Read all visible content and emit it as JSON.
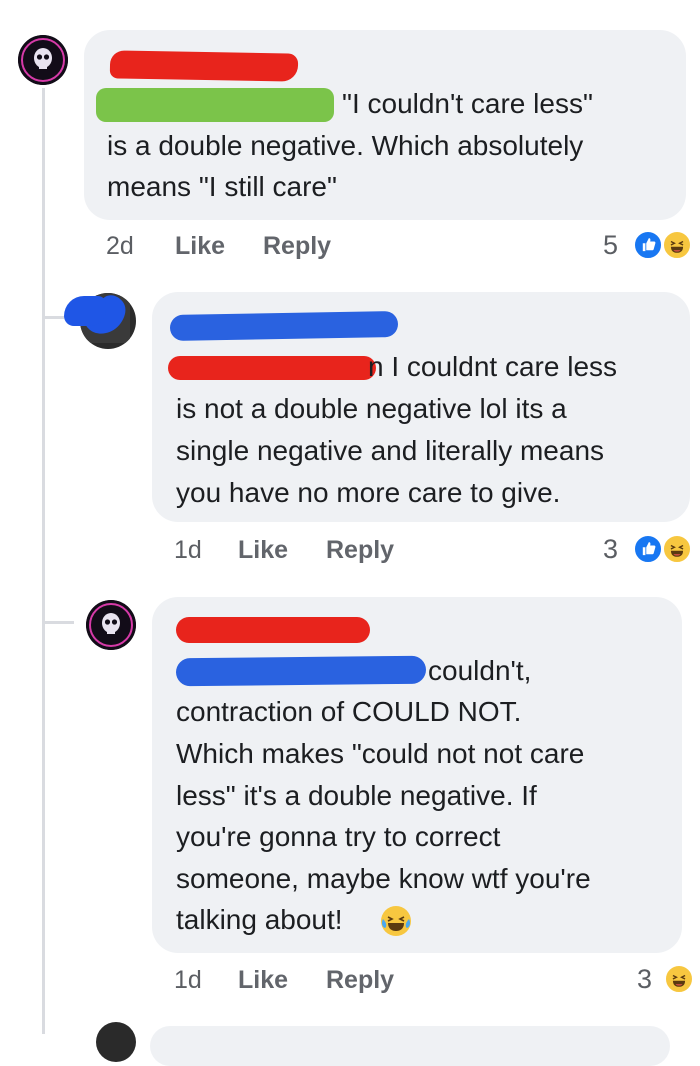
{
  "comments": [
    {
      "redacted_name": "",
      "text_lines": [
        "\"I couldn't care less\"",
        "is a double negative. Which absolutely",
        "means \"I still care\""
      ],
      "time": "2d",
      "like_label": "Like",
      "reply_label": "Reply",
      "reaction_count": "5",
      "reactions": [
        "like-icon",
        "haha-icon"
      ]
    },
    {
      "redacted_name": "",
      "text_lines": [
        "n I couldnt care less",
        "is not a double negative lol its a",
        "single negative and literally means",
        "you have no more care to give."
      ],
      "time": "1d",
      "like_label": "Like",
      "reply_label": "Reply",
      "reaction_count": "3",
      "reactions": [
        "like-icon",
        "haha-icon"
      ]
    },
    {
      "redacted_name": "",
      "text_lines": [
        "couldn't,",
        "contraction of COULD NOT.",
        "Which makes \"could not not care",
        "less\" it's a double negative. If",
        "you're gonna try to correct",
        "someone, maybe know wtf you're",
        "talking about!"
      ],
      "inline_emoji": "tears-of-joy-emoji",
      "time": "1d",
      "like_label": "Like",
      "reply_label": "Reply",
      "reaction_count": "3",
      "reactions": [
        "haha-icon"
      ]
    }
  ],
  "colors": {
    "bubble": "#eff1f4",
    "redact_red": "#e8241c",
    "redact_green": "#7bc44a",
    "redact_blue": "#2a62e0",
    "like_blue": "#1877f2"
  }
}
